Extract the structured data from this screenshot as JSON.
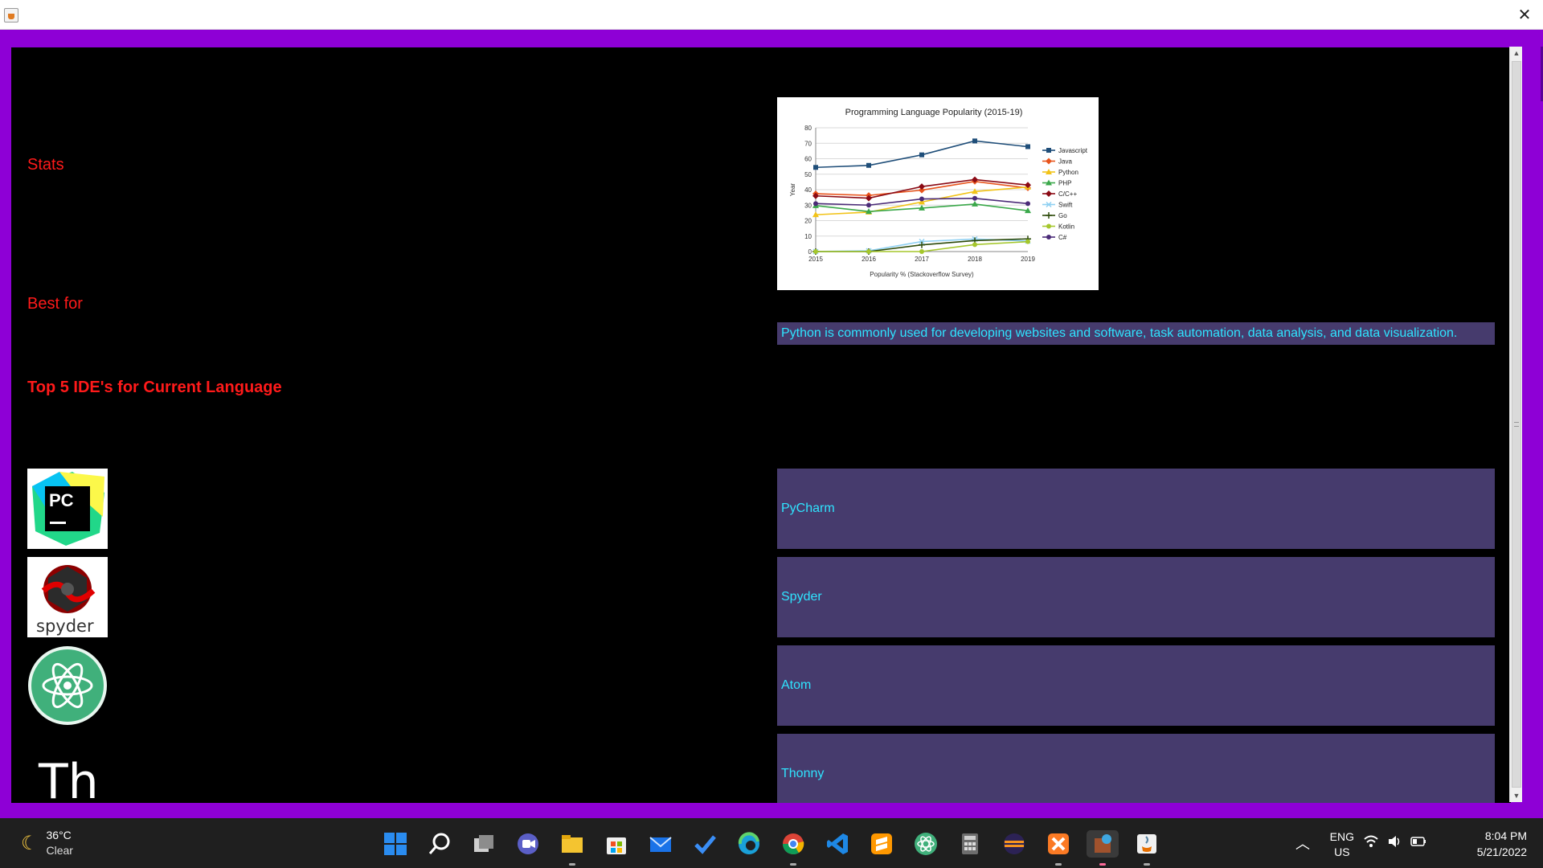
{
  "window": {
    "close_glyph": "✕"
  },
  "labels": {
    "stats": "Stats",
    "best_for": "Best for",
    "top_ides": "Top 5 IDE's for Current Language"
  },
  "best_for_text": "Python is commonly used for developing websites and software, task automation, data analysis, and data visualization.",
  "ides": [
    {
      "name": "PyCharm",
      "icon": "pycharm-logo"
    },
    {
      "name": "Spyder",
      "icon": "spyder-logo"
    },
    {
      "name": "Atom",
      "icon": "atom-logo"
    },
    {
      "name": "Thonny",
      "icon": "thonny-logo"
    },
    {
      "name": "",
      "icon": "partial-logo"
    }
  ],
  "logo_text": {
    "pycharm": "PC",
    "spyder": "spyder",
    "thonny": "Th"
  },
  "chart_data": {
    "type": "line",
    "title": "Programming Language Popularity (2015-19)",
    "xlabel": "Popularity % (Stackoverflow Survey)",
    "ylabel": "Year",
    "x": [
      "2015",
      "2016",
      "2017",
      "2018",
      "2019"
    ],
    "ylim": [
      0,
      80
    ],
    "yticks": [
      "0",
      "10",
      "20",
      "30",
      "40",
      "50",
      "60",
      "70",
      "80"
    ],
    "grid": true,
    "legend": "right",
    "series": [
      {
        "name": "Javascript",
        "color": "#1f4e79",
        "marker": "square",
        "values": [
          54.4,
          55.7,
          62.5,
          71.5,
          67.8
        ]
      },
      {
        "name": "Java",
        "color": "#e8541c",
        "marker": "diamond",
        "values": [
          37.4,
          36.3,
          39.7,
          45.3,
          41.1
        ]
      },
      {
        "name": "Python",
        "color": "#f2c318",
        "marker": "triangle",
        "values": [
          23.8,
          25.5,
          32.0,
          38.8,
          41.7
        ]
      },
      {
        "name": "PHP",
        "color": "#3aa84a",
        "marker": "triangle",
        "values": [
          29.7,
          25.9,
          28.1,
          30.7,
          26.4
        ]
      },
      {
        "name": "C/C++",
        "color": "#8b0a14",
        "marker": "diamond",
        "values": [
          36.0,
          34.5,
          42.0,
          46.5,
          43.0
        ]
      },
      {
        "name": "Swift",
        "color": "#8fd0f2",
        "marker": "x",
        "values": [
          0.0,
          0.5,
          6.5,
          8.1,
          6.8
        ]
      },
      {
        "name": "Go",
        "color": "#2d4a0a",
        "marker": "cross",
        "values": [
          0.0,
          0.0,
          4.3,
          7.1,
          8.2
        ]
      },
      {
        "name": "Kotlin",
        "color": "#a5c72c",
        "marker": "circle",
        "values": [
          0.0,
          0.0,
          0.0,
          4.5,
          6.4
        ]
      },
      {
        "name": "C#",
        "color": "#4b2b78",
        "marker": "circle",
        "values": [
          31.0,
          30.0,
          34.0,
          34.4,
          31.0
        ]
      }
    ]
  },
  "taskbar": {
    "weather": {
      "temp": "36°C",
      "condition": "Clear"
    },
    "apps": [
      "start",
      "search",
      "task-view",
      "chat",
      "file-explorer",
      "store",
      "mail",
      "todo",
      "edge",
      "chrome",
      "vscode",
      "sublime",
      "atom",
      "calculator",
      "eclipse",
      "xampp",
      "app-running",
      "java"
    ],
    "lang_top": "ENG",
    "lang_bottom": "US",
    "time": "8:04 PM",
    "date": "5/21/2022"
  }
}
